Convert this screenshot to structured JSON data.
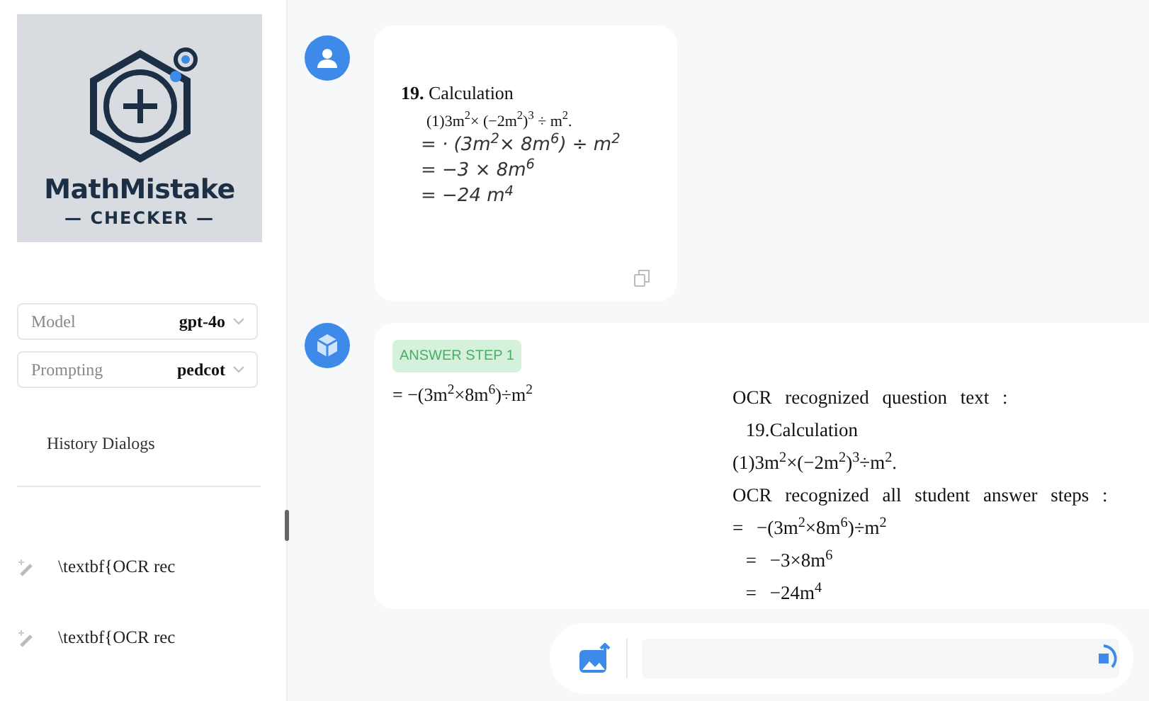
{
  "logo": {
    "title": "MathMistake",
    "subtitle": "— CHECKER —"
  },
  "selects": [
    {
      "label": "Model",
      "value": "gpt-4o"
    },
    {
      "label": "Prompting",
      "value": "pedcot"
    }
  ],
  "history": {
    "title": "History Dialogs",
    "items": [
      "\\textbf{OCR rec",
      "\\textbf{OCR rec"
    ]
  },
  "messages": [
    {
      "kind": "user",
      "lines": [
        {
          "kind": "heading",
          "text": "**19.** Calculation"
        },
        {
          "kind": "printed",
          "text": "(1)3m$^{2}$× (−2m$^{2}$)$^{3}$ ÷ m$^{2}$."
        },
        {
          "kind": "hand",
          "text": "= · (3m$^{2}$× 8m$^{6}$) ÷ m$^{2}$"
        },
        {
          "kind": "hand",
          "text": "= −3 × 8m$^{6}$"
        },
        {
          "kind": "hand",
          "text": "= −24 m$^{4}$"
        }
      ]
    },
    {
      "kind": "bot",
      "badge": "ANSWER STEP 1",
      "step": "= −(3m$^{2}$×8m$^{6}$)÷m$^{2}$",
      "lines": [
        "OCR recognized question text :",
        " 19.Calculation",
        "(1)3m$^{2}$×(−2m$^{2}$)$^{3}$÷m$^{2}$.",
        "OCR recognized all student answer steps :",
        "= −(3m$^{2}$×8m$^{6}$)÷m$^{2}$",
        " = −3×8m$^{6}$",
        " = −24m$^{4}$"
      ]
    }
  ]
}
